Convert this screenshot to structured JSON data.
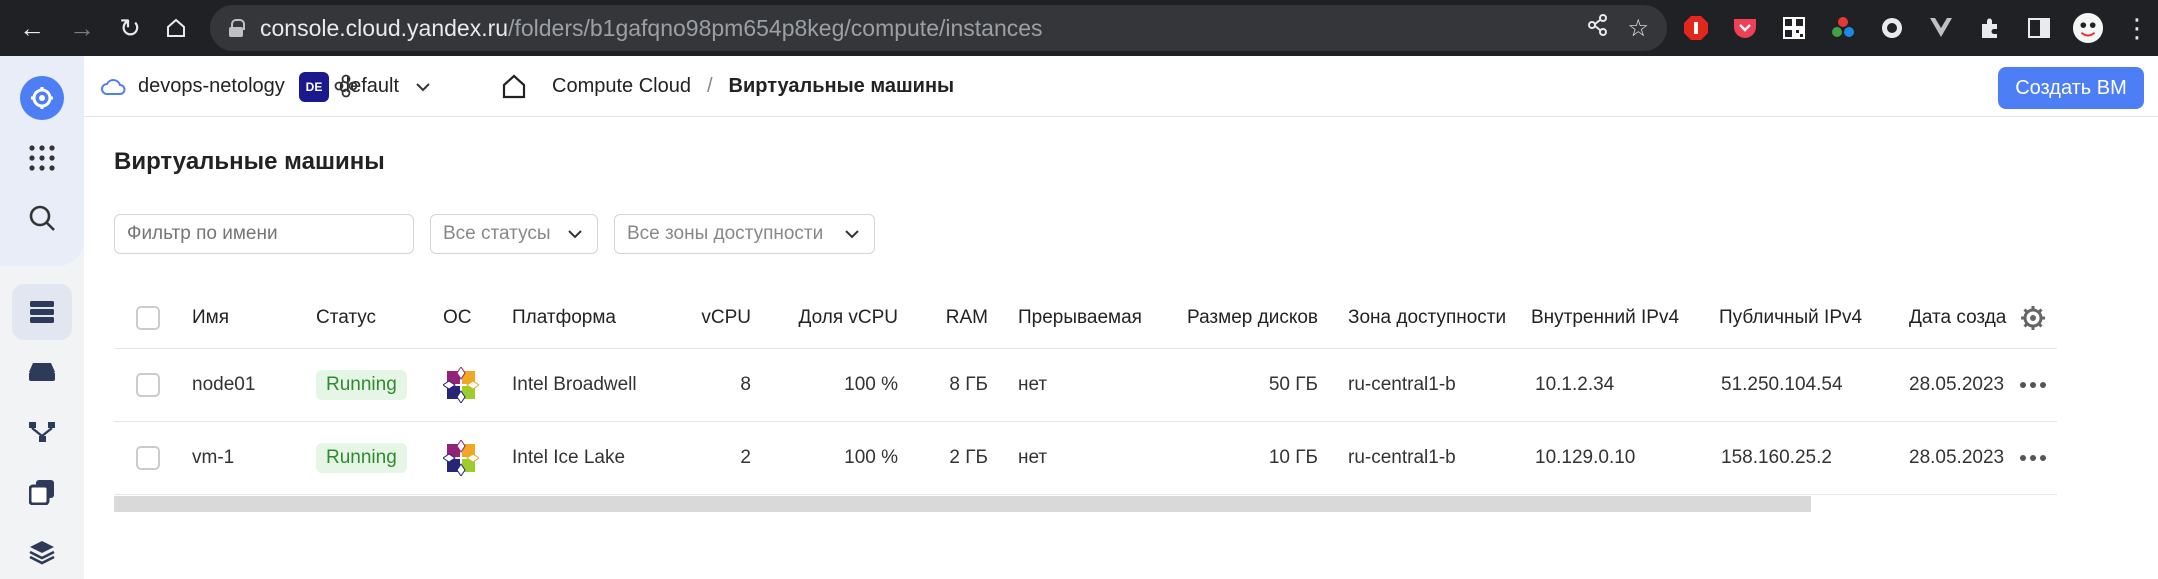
{
  "browser": {
    "url_host": "console.cloud.yandex.ru",
    "url_path": "/folders/b1gafqno98pm654p8keg/compute/instances"
  },
  "header": {
    "cloud_name": "devops-netology",
    "folder_badge": "DE",
    "folder_name": "default",
    "breadcrumb_service": "Compute Cloud",
    "breadcrumb_sep": "/",
    "breadcrumb_current": "Виртуальные машины",
    "create_button": "Создать ВМ"
  },
  "page": {
    "title": "Виртуальные машины",
    "filter_placeholder": "Фильтр по имени",
    "status_select": "Все статусы",
    "zone_select": "Все зоны доступности"
  },
  "table": {
    "columns": [
      "Имя",
      "Статус",
      "ОС",
      "Платформа",
      "vCPU",
      "Доля vCPU",
      "RAM",
      "Прерываемая",
      "Размер дисков",
      "Зона доступности",
      "Внутренний IPv4",
      "Публичный IPv4",
      "Дата созда"
    ],
    "rows": [
      {
        "name": "node01",
        "status": "Running",
        "platform": "Intel Broadwell",
        "vcpu": "8",
        "vcpu_share": "100 %",
        "ram": "8 ГБ",
        "preemptible": "нет",
        "disk": "50 ГБ",
        "zone": "ru-central1-b",
        "internal_ip": "10.1.2.34",
        "public_ip": "51.250.104.54",
        "date": "28.05.2023"
      },
      {
        "name": "vm-1",
        "status": "Running",
        "platform": "Intel Ice Lake",
        "vcpu": "2",
        "vcpu_share": "100 %",
        "ram": "2 ГБ",
        "preemptible": "нет",
        "disk": "10 ГБ",
        "zone": "ru-central1-b",
        "internal_ip": "10.129.0.10",
        "public_ip": "158.160.25.2",
        "date": "28.05.2023"
      }
    ]
  },
  "colors": {
    "accent": "#4d7ef6",
    "status_running_bg": "#e6f6e6",
    "status_running_fg": "#2f8a2f"
  }
}
